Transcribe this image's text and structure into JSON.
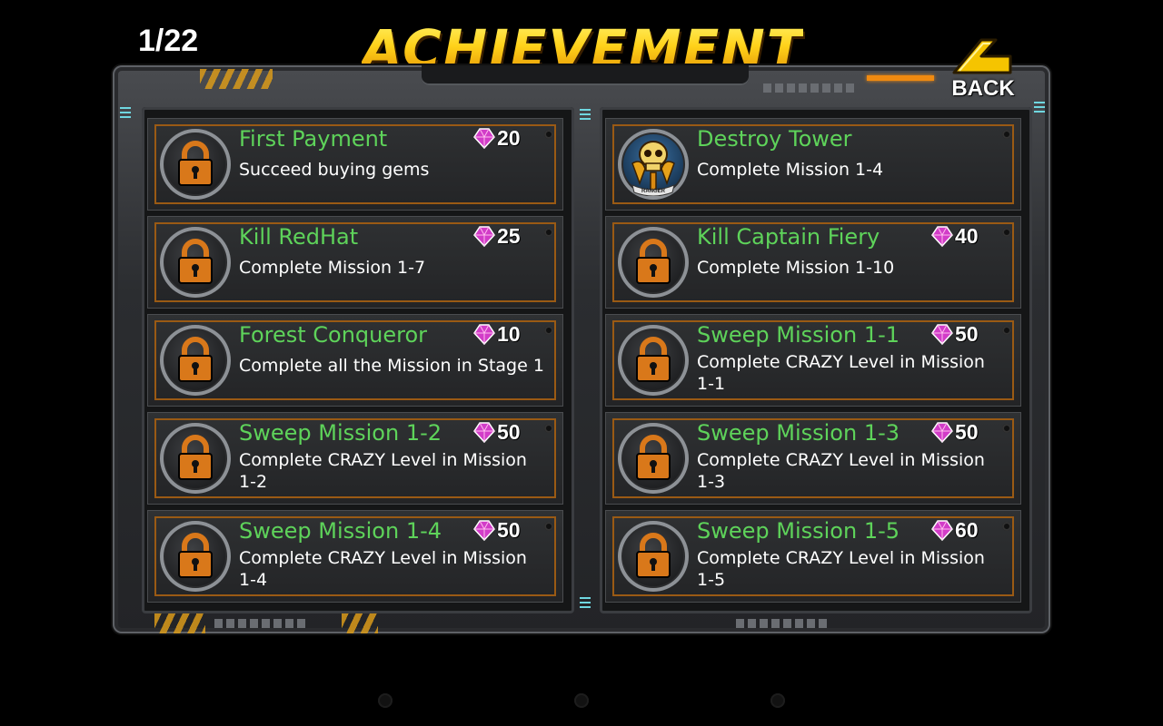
{
  "header": {
    "counter": "1/22",
    "title": "ACHIEVEMENT",
    "back_label": "BACK"
  },
  "colors": {
    "title_gold": "#f7c20e",
    "achievement_name": "#5ed35a",
    "card_border": "#9a5a14",
    "lock_orange": "#d9781a"
  },
  "achievements": {
    "left": [
      {
        "name": "First Payment",
        "desc": "Succeed buying gems",
        "reward": "20",
        "icon": "lock-icon"
      },
      {
        "name": "Kill RedHat",
        "desc": "Complete Mission 1-7",
        "reward": "25",
        "icon": "lock-icon"
      },
      {
        "name": "Forest Conqueror",
        "desc": "Complete all the Mission in Stage 1",
        "reward": "10",
        "icon": "lock-icon"
      },
      {
        "name": "Sweep Mission 1-2",
        "desc": "Complete CRAZY Level in Mission 1-2",
        "reward": "50",
        "icon": "lock-icon"
      },
      {
        "name": "Sweep Mission 1-4",
        "desc": "Complete CRAZY Level in Mission 1-4",
        "reward": "50",
        "icon": "lock-icon"
      }
    ],
    "right": [
      {
        "name": "Destroy Tower",
        "desc": "Complete Mission 1-4",
        "reward": "",
        "icon": "ranger-skull-icon",
        "badge_text": "RANGER"
      },
      {
        "name": "Kill Captain Fiery",
        "desc": "Complete Mission 1-10",
        "reward": "40",
        "icon": "lock-icon"
      },
      {
        "name": "Sweep Mission 1-1",
        "desc": "Complete CRAZY Level in Mission 1-1",
        "reward": "50",
        "icon": "lock-icon"
      },
      {
        "name": "Sweep Mission 1-3",
        "desc": "Complete CRAZY Level in Mission 1-3",
        "reward": "50",
        "icon": "lock-icon"
      },
      {
        "name": "Sweep Mission 1-5",
        "desc": "Complete CRAZY Level in Mission 1-5",
        "reward": "60",
        "icon": "lock-icon"
      }
    ]
  }
}
